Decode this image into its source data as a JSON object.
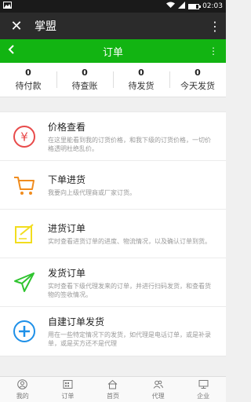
{
  "status_bar": {
    "time": "02:03",
    "battery_level": 0.75,
    "icons": [
      "image-icon",
      "wifi-icon",
      "signal-icon",
      "battery-icon"
    ]
  },
  "app_bar": {
    "title": "掌盟"
  },
  "header": {
    "title": "订单"
  },
  "stats": [
    {
      "count": "0",
      "label": "待付款"
    },
    {
      "count": "0",
      "label": "待查账"
    },
    {
      "count": "0",
      "label": "待发货"
    },
    {
      "count": "0",
      "label": "今天发货"
    }
  ],
  "menu": [
    {
      "title": "价格查看",
      "desc": "在这里能看到我的订货价格，和我下级的订货价格，一切价格透明杜绝乱价。",
      "icon": "yen-icon",
      "color": "#e84a4a"
    },
    {
      "title": "下单进货",
      "desc": "我要向上级代理商或厂家订货。",
      "icon": "cart-icon",
      "color": "#f08c1e"
    },
    {
      "title": "进货订单",
      "desc": "实时查看进货订单的进度、物流情况，以及确认订单到货。",
      "icon": "edit-icon",
      "color": "#f2dd1e"
    },
    {
      "title": "发货订单",
      "desc": "实时查看下级代理发来的订单，并进行扫码发货，和查看货物的签收情况。",
      "icon": "send-icon",
      "color": "#2fc42f"
    },
    {
      "title": "自建订单发货",
      "desc": "用在一些特定情况下的发货，如代理是电话订单，或是补录单，或是买方还不是代理",
      "icon": "plus-circle-icon",
      "color": "#1e90e8"
    }
  ],
  "tabs": [
    {
      "label": "我的",
      "icon": "user-icon"
    },
    {
      "label": "订单",
      "icon": "order-icon"
    },
    {
      "label": "首页",
      "icon": "home-icon"
    },
    {
      "label": "代理",
      "icon": "agents-icon"
    },
    {
      "label": "企业",
      "icon": "monitor-icon"
    }
  ]
}
